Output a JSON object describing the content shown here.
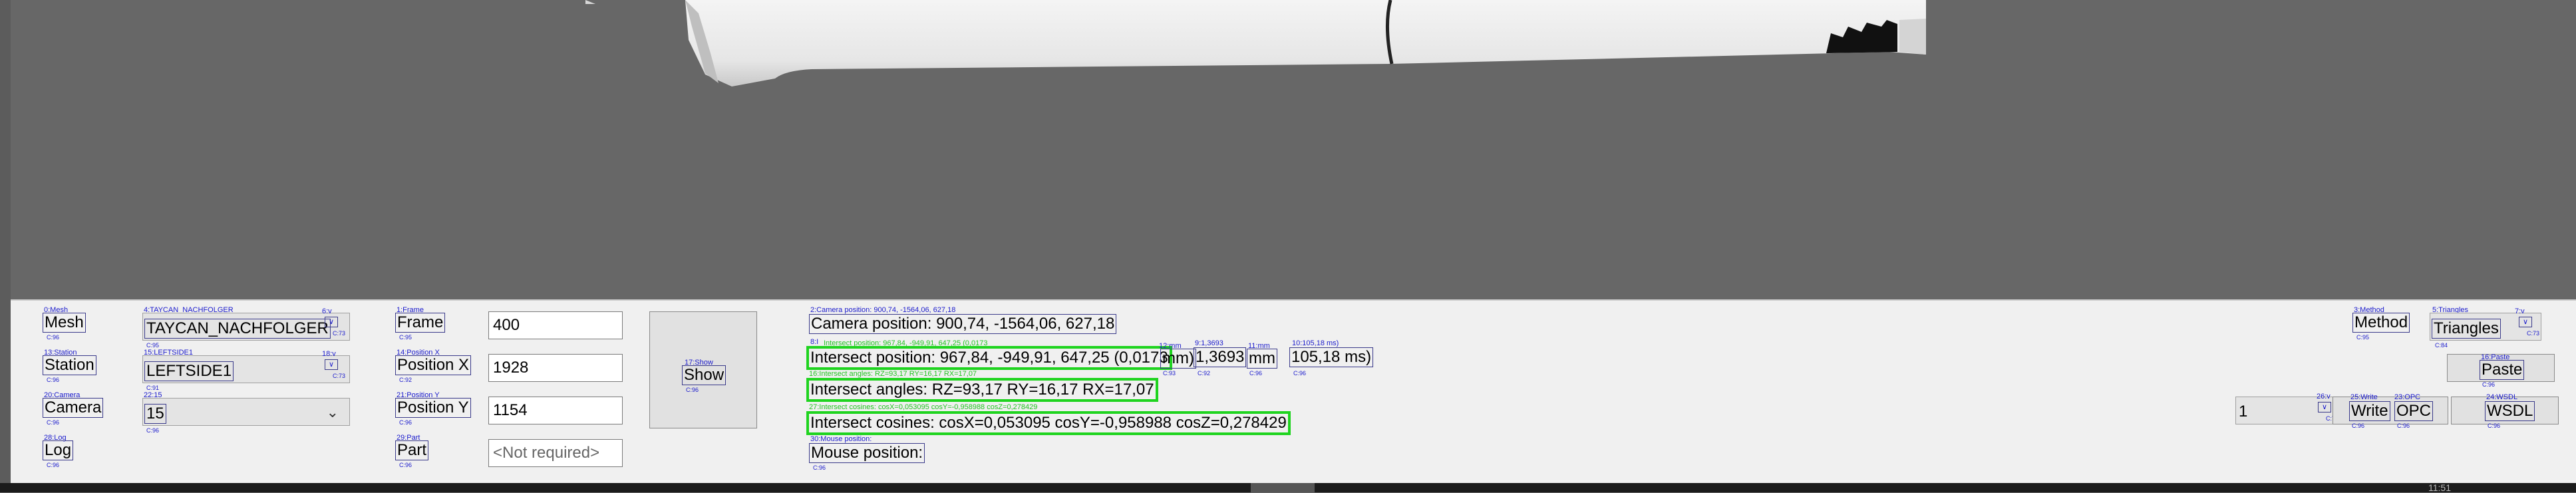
{
  "mesh": {
    "id": "0:Mesh",
    "label": "Mesh",
    "cid": "C:96",
    "combo_id": "4:TAYCAN_NACHFOLGER",
    "combo_value": "TAYCAN_NACHFOLGER",
    "combo_cid": "C:95",
    "check_id": "6:v",
    "check_cid": "C:73"
  },
  "station": {
    "id": "13:Station",
    "label": "Station",
    "cid": "C:96",
    "combo_id": "15:LEFTSIDE1",
    "combo_value": "LEFTSIDE1",
    "combo_cid": "C:91",
    "check_id": "18:v",
    "check_cid": "C:73"
  },
  "camera": {
    "id": "20:Camera",
    "label": "Camera",
    "cid": "C:96",
    "combo_id": "22:15",
    "combo_value": "15",
    "combo_cid": "C:96"
  },
  "log": {
    "id": "28:Log",
    "label": "Log",
    "cid": "C:96"
  },
  "frame": {
    "id": "1:Frame",
    "label": "Frame",
    "cid": "C:95",
    "value": "400"
  },
  "pos_x": {
    "id": "14:Position X",
    "label": "Position X",
    "cid": "C:92",
    "value": "1928"
  },
  "pos_y": {
    "id": "21:Position Y",
    "label": "Position Y",
    "cid": "C:96",
    "value": "1154"
  },
  "part": {
    "id": "29:Part",
    "label": "Part",
    "cid": "C:96",
    "placeholder": "<Not required>"
  },
  "show": {
    "id": "17:Show",
    "label": "Show",
    "cid": "C:96"
  },
  "cam_pos": {
    "id": "2:Camera position: 900,74, -1564,06, 627,18",
    "text": "Camera position: 900,74, -1564,06, 627,18"
  },
  "intersect_pos": {
    "id": "8:I",
    "ghost": "Intersect position: 967,84, -949,91, 647,25 (0,0173",
    "text": "Intersect position: 967,84, -949,91, 647,25 (0,0173",
    "unit1": "mm)",
    "unit1_id": "12:mm",
    "unit1_cid": "C:93",
    "val2": "1,3693",
    "val2_id": "9:1,3693",
    "val2_cid": "C:92",
    "unit2": "mm",
    "unit2_id": "11:mm",
    "unit2_cid": "C:96",
    "val3": "105,18 ms)",
    "val3_id": "10:105,18 ms)",
    "val3_cid": "C:96"
  },
  "intersect_angles": {
    "ghost": "16:Intersect angles: RZ=93,17 RY=16,17 RX=17,07",
    "text": "Intersect angles: RZ=93,17 RY=16,17 RX=17,07"
  },
  "intersect_cos": {
    "ghost": "27:Intersect cosines: cosX=0,053095 cosY=-0,958988 cosZ=0,278429",
    "text": "Intersect cosines: cosX=0,053095 cosY=-0,958988 cosZ=0,278429"
  },
  "mouse_pos": {
    "id": "30:Mouse position:",
    "text": "Mouse position:",
    "cid": "C:96"
  },
  "method": {
    "id": "3:Method",
    "label": "Method",
    "cid": "C:95"
  },
  "triangles": {
    "id": "5:Triangles",
    "value": "Triangles",
    "cid": "C:84",
    "check_id": "7:v",
    "check_cid": "C:73"
  },
  "paste": {
    "id": "16:Paste",
    "label": "Paste",
    "cid": "C:96"
  },
  "count": {
    "value": "1",
    "check_id": "26:v",
    "check_cid": "C:73"
  },
  "write": {
    "id": "25:Write",
    "label": "Write",
    "cid": "C:96"
  },
  "opc": {
    "id": "23:OPC",
    "label": "OPC",
    "cid": "C:96"
  },
  "wsdl": {
    "id": "24:WSDL",
    "label": "WSDL",
    "cid": "C:96"
  },
  "taskbar": {
    "clock": "11:51"
  },
  "colors": {
    "viewport": "#676767",
    "panel": "#f0f0f0",
    "highlight": "#1fd41f",
    "annotation": "#1a1acc"
  }
}
